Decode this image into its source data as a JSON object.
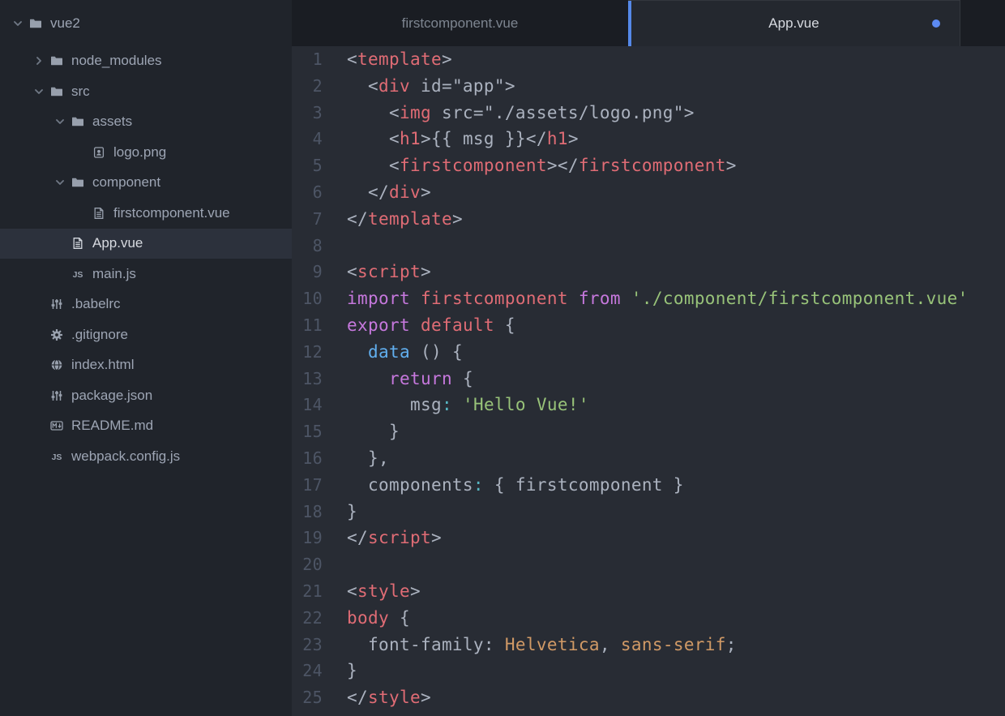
{
  "colors": {
    "editor_bg": "#282c34",
    "sidebar_bg": "#20242b",
    "tabbar_bg": "#1a1d23",
    "active_tab_bg": "#24282f",
    "selected_row_bg": "#2c313c",
    "accent_blue": "#5588e8",
    "modified_dot_blue": "#5c8af2",
    "text_gray": "#9da5b4",
    "syntax_tag_red": "#e06c75",
    "syntax_keyword_purple": "#c678dd",
    "syntax_function_blue": "#61afef",
    "syntax_string_green": "#98c379",
    "syntax_colon_cyan": "#56b6c2",
    "syntax_value_orange": "#d19a66"
  },
  "tabs": {
    "items": [
      {
        "label": "firstcomponent.vue",
        "active": false,
        "modified": false
      },
      {
        "label": "App.vue",
        "active": true,
        "modified": true
      }
    ]
  },
  "sidebar": {
    "tree": [
      {
        "label": "vue2",
        "icon": "folder",
        "level": 0,
        "expanded": true,
        "selected": false
      },
      {
        "label": "node_modules",
        "icon": "folder",
        "level": 1,
        "expanded": false,
        "selected": false
      },
      {
        "label": "src",
        "icon": "folder",
        "level": 1,
        "expanded": true,
        "selected": false
      },
      {
        "label": "assets",
        "icon": "folder",
        "level": 2,
        "expanded": true,
        "selected": false
      },
      {
        "label": "logo.png",
        "icon": "image",
        "level": 3,
        "expanded": null,
        "selected": false
      },
      {
        "label": "component",
        "icon": "folder",
        "level": 2,
        "expanded": true,
        "selected": false
      },
      {
        "label": "firstcomponent.vue",
        "icon": "file-text",
        "level": 3,
        "expanded": null,
        "selected": false
      },
      {
        "label": "App.vue",
        "icon": "file-text",
        "level": 2,
        "expanded": null,
        "selected": true
      },
      {
        "label": "main.js",
        "icon": "js",
        "level": 2,
        "expanded": null,
        "selected": false
      },
      {
        "label": ".babelrc",
        "icon": "settings",
        "level": 1,
        "expanded": null,
        "selected": false
      },
      {
        "label": ".gitignore",
        "icon": "gear",
        "level": 1,
        "expanded": null,
        "selected": false
      },
      {
        "label": "index.html",
        "icon": "globe",
        "level": 1,
        "expanded": null,
        "selected": false
      },
      {
        "label": "package.json",
        "icon": "settings",
        "level": 1,
        "expanded": null,
        "selected": false
      },
      {
        "label": "README.md",
        "icon": "markdown",
        "level": 1,
        "expanded": null,
        "selected": false
      },
      {
        "label": "webpack.config.js",
        "icon": "js",
        "level": 1,
        "expanded": null,
        "selected": false
      }
    ]
  },
  "editor": {
    "lines": [
      {
        "n": 1,
        "tokens": [
          [
            "pln",
            "<"
          ],
          [
            "tag",
            "template"
          ],
          [
            "pln",
            ">"
          ]
        ]
      },
      {
        "n": 2,
        "tokens": [
          [
            "pln",
            "  <"
          ],
          [
            "tag",
            "div"
          ],
          [
            "pln",
            " id=\"app\">"
          ]
        ]
      },
      {
        "n": 3,
        "tokens": [
          [
            "pln",
            "    <"
          ],
          [
            "tag",
            "img"
          ],
          [
            "pln",
            " src=\"./assets/logo.png\">"
          ]
        ]
      },
      {
        "n": 4,
        "tokens": [
          [
            "pln",
            "    <"
          ],
          [
            "tag",
            "h1"
          ],
          [
            "pln",
            ">{{ msg }}</"
          ],
          [
            "tag",
            "h1"
          ],
          [
            "pln",
            ">"
          ]
        ]
      },
      {
        "n": 5,
        "tokens": [
          [
            "pln",
            "    <"
          ],
          [
            "tag",
            "firstcomponent"
          ],
          [
            "pln",
            "></"
          ],
          [
            "tag",
            "firstcomponent"
          ],
          [
            "pln",
            ">"
          ]
        ]
      },
      {
        "n": 6,
        "tokens": [
          [
            "pln",
            "  </"
          ],
          [
            "tag",
            "div"
          ],
          [
            "pln",
            ">"
          ]
        ]
      },
      {
        "n": 7,
        "tokens": [
          [
            "pln",
            "</"
          ],
          [
            "tag",
            "template"
          ],
          [
            "pln",
            ">"
          ]
        ]
      },
      {
        "n": 8,
        "tokens": []
      },
      {
        "n": 9,
        "tokens": [
          [
            "pln",
            "<"
          ],
          [
            "tag",
            "script"
          ],
          [
            "pln",
            ">"
          ]
        ]
      },
      {
        "n": 10,
        "tokens": [
          [
            "kw",
            "import"
          ],
          [
            "pln",
            " "
          ],
          [
            "tag",
            "firstcomponent"
          ],
          [
            "pln",
            " "
          ],
          [
            "kw",
            "from"
          ],
          [
            "pln",
            " "
          ],
          [
            "str",
            "'./component/firstcomponent.vue'"
          ]
        ]
      },
      {
        "n": 11,
        "tokens": [
          [
            "kw",
            "export"
          ],
          [
            "pln",
            " "
          ],
          [
            "tag",
            "default"
          ],
          [
            "pln",
            " {"
          ]
        ]
      },
      {
        "n": 12,
        "tokens": [
          [
            "pln",
            "  "
          ],
          [
            "fn",
            "data"
          ],
          [
            "pln",
            " () {"
          ]
        ]
      },
      {
        "n": 13,
        "tokens": [
          [
            "pln",
            "    "
          ],
          [
            "kw",
            "return"
          ],
          [
            "pln",
            " {"
          ]
        ]
      },
      {
        "n": 14,
        "tokens": [
          [
            "pln",
            "      msg"
          ],
          [
            "op",
            ":"
          ],
          [
            "pln",
            " "
          ],
          [
            "str",
            "'Hello Vue!'"
          ]
        ]
      },
      {
        "n": 15,
        "tokens": [
          [
            "pln",
            "    }"
          ]
        ]
      },
      {
        "n": 16,
        "tokens": [
          [
            "pln",
            "  },"
          ]
        ]
      },
      {
        "n": 17,
        "tokens": [
          [
            "pln",
            "  components"
          ],
          [
            "op",
            ":"
          ],
          [
            "pln",
            " { firstcomponent }"
          ]
        ]
      },
      {
        "n": 18,
        "tokens": [
          [
            "pln",
            "}"
          ]
        ]
      },
      {
        "n": 19,
        "tokens": [
          [
            "pln",
            "</"
          ],
          [
            "tag",
            "script"
          ],
          [
            "pln",
            ">"
          ]
        ]
      },
      {
        "n": 20,
        "tokens": []
      },
      {
        "n": 21,
        "tokens": [
          [
            "pln",
            "<"
          ],
          [
            "tag",
            "style"
          ],
          [
            "pln",
            ">"
          ]
        ]
      },
      {
        "n": 22,
        "tokens": [
          [
            "tag",
            "body"
          ],
          [
            "pln",
            " {"
          ]
        ]
      },
      {
        "n": 23,
        "tokens": [
          [
            "pln",
            "  font-family: "
          ],
          [
            "val",
            "Helvetica"
          ],
          [
            "pln",
            ", "
          ],
          [
            "val",
            "sans-serif"
          ],
          [
            "pln",
            ";"
          ]
        ]
      },
      {
        "n": 24,
        "tokens": [
          [
            "pln",
            "}"
          ]
        ]
      },
      {
        "n": 25,
        "tokens": [
          [
            "pln",
            "</"
          ],
          [
            "tag",
            "style"
          ],
          [
            "pln",
            ">"
          ]
        ]
      }
    ]
  }
}
